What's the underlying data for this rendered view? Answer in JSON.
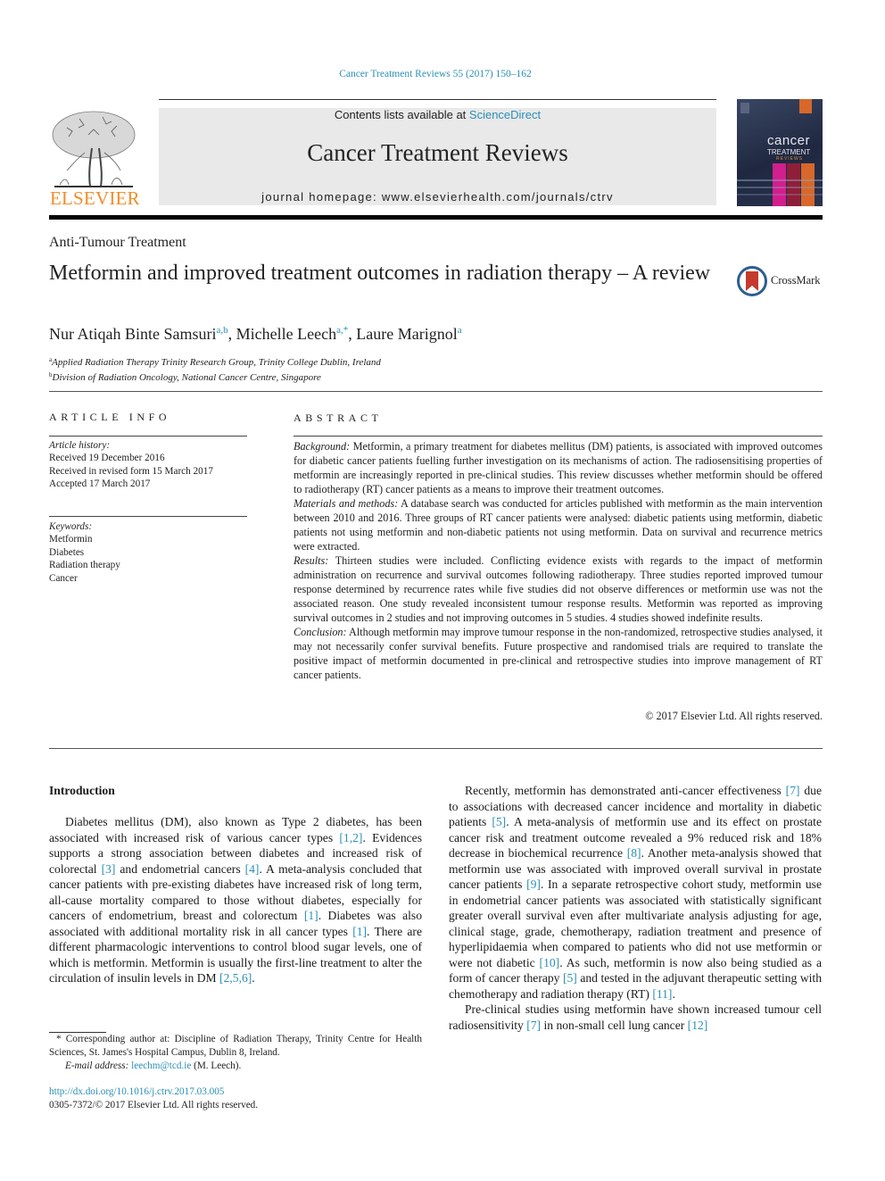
{
  "header": {
    "journal_citation": "Cancer Treatment Reviews 55 (2017) 150–162",
    "contents_prefix": "Contents lists available at ",
    "contents_link": "ScienceDirect",
    "journal_name": "Cancer Treatment Reviews",
    "homepage": "journal homepage: www.elsevierhealth.com/journals/ctrv",
    "publisher_logo_text": "ELSEVIER",
    "cover_title_line1": "cancer",
    "cover_title_line2": "TREATMENT",
    "cover_title_line3": "REVIEWS"
  },
  "article": {
    "section": "Anti-Tumour Treatment",
    "title": "Metformin and improved treatment outcomes in radiation therapy – A review",
    "crossmark_label": "CrossMark",
    "authors": [
      {
        "name": "Nur Atiqah Binte Samsuri",
        "sup": "a,b"
      },
      {
        "name": "Michelle Leech",
        "sup": "a,*"
      },
      {
        "name": "Laure Marignol",
        "sup": "a"
      }
    ],
    "affiliations": [
      {
        "mark": "a",
        "text": "Applied Radiation Therapy Trinity Research Group, Trinity College Dublin, Ireland"
      },
      {
        "mark": "b",
        "text": "Division of Radiation Oncology, National Cancer Centre, Singapore"
      }
    ]
  },
  "article_info": {
    "heading": "ARTICLE INFO",
    "history_label": "Article history:",
    "history": [
      "Received 19 December 2016",
      "Received in revised form 15 March 2017",
      "Accepted 17 March 2017"
    ],
    "keywords_label": "Keywords:",
    "keywords": [
      "Metformin",
      "Diabetes",
      "Radiation therapy",
      "Cancer"
    ]
  },
  "abstract": {
    "heading": "ABSTRACT",
    "sections": [
      {
        "label": "Background:",
        "text": "Metformin, a primary treatment for diabetes mellitus (DM) patients, is associated with improved outcomes for diabetic cancer patients fuelling further investigation on its mechanisms of action. The radiosensitising properties of metformin are increasingly reported in pre-clinical studies. This review discusses whether metformin should be offered to radiotherapy (RT) cancer patients as a means to improve their treatment outcomes."
      },
      {
        "label": "Materials and methods:",
        "text": "A database search was conducted for articles published with metformin as the main intervention between 2010 and 2016. Three groups of RT cancer patients were analysed: diabetic patients using metformin, diabetic patients not using metformin and non-diabetic patients not using metformin. Data on survival and recurrence metrics were extracted."
      },
      {
        "label": "Results:",
        "text": "Thirteen studies were included. Conflicting evidence exists with regards to the impact of metformin administration on recurrence and survival outcomes following radiotherapy. Three studies reported improved tumour response determined by recurrence rates while five studies did not observe differences or metformin use was not the associated reason. One study revealed inconsistent tumour response results. Metformin was reported as improving survival outcomes in 2 studies and not improving outcomes in 5 studies. 4 studies showed indefinite results."
      },
      {
        "label": "Conclusion:",
        "text": "Although metformin may improve tumour response in the non-randomized, retrospective studies analysed, it may not necessarily confer survival benefits. Future prospective and randomised trials are required to translate the positive impact of metformin documented in pre-clinical and retrospective studies into improve management of RT cancer patients."
      }
    ],
    "copyright": "© 2017 Elsevier Ltd. All rights reserved."
  },
  "body": {
    "intro_heading": "Introduction",
    "left_paragraph": [
      {
        "t": "Diabetes mellitus (DM), also known as Type 2 diabetes, has been associated with increased risk of various cancer types "
      },
      {
        "ref": "[1,2]"
      },
      {
        "t": ". Evidences supports a strong association between diabetes and increased risk of colorectal "
      },
      {
        "ref": "[3]"
      },
      {
        "t": " and endometrial cancers "
      },
      {
        "ref": "[4]"
      },
      {
        "t": ". A meta-analysis concluded that cancer patients with pre-existing diabetes have increased risk of long term, all-cause mortality compared to those without diabetes, especially for cancers of endometrium, breast and colorectum "
      },
      {
        "ref": "[1]"
      },
      {
        "t": ". Diabetes was also associated with additional mortality risk in all cancer types "
      },
      {
        "ref": "[1]"
      },
      {
        "t": ". There are different pharmacologic interventions to control blood sugar levels, one of which is metformin. Metformin is usually the first-line treatment to alter the circulation of insulin levels in DM "
      },
      {
        "ref": "[2,5,6]"
      },
      {
        "t": "."
      }
    ],
    "right_paragraph_1": [
      {
        "t": "Recently, metformin has demonstrated anti-cancer effectiveness "
      },
      {
        "ref": "[7]"
      },
      {
        "t": " due to associations with decreased cancer incidence and mortality in diabetic patients "
      },
      {
        "ref": "[5]"
      },
      {
        "t": ". A meta-analysis of metformin use and its effect on prostate cancer risk and treatment outcome revealed a 9% reduced risk and 18% decrease in biochemical recurrence "
      },
      {
        "ref": "[8]"
      },
      {
        "t": ". Another meta-analysis showed that metformin use was associated with improved overall survival in prostate cancer patients "
      },
      {
        "ref": "[9]"
      },
      {
        "t": ". In a separate retrospective cohort study, metformin use in endometrial cancer patients was associated with statistically significant greater overall survival even after multivariate analysis adjusting for age, clinical stage, grade, chemotherapy, radiation treatment and presence of hyperlipidaemia when compared to patients who did not use metformin or were not diabetic "
      },
      {
        "ref": "[10]"
      },
      {
        "t": ". As such, metformin is now also being studied as a form of cancer therapy "
      },
      {
        "ref": "[5]"
      },
      {
        "t": " and tested in the adjuvant therapeutic setting with chemotherapy and radiation therapy (RT) "
      },
      {
        "ref": "[11]"
      },
      {
        "t": "."
      }
    ],
    "right_paragraph_2": [
      {
        "t": "Pre-clinical studies using metformin have shown increased tumour cell radiosensitivity "
      },
      {
        "ref": "[7]"
      },
      {
        "t": " in non-small cell lung cancer "
      },
      {
        "ref": "[12]"
      }
    ]
  },
  "footnote": {
    "corresponding": "* Corresponding author at: Discipline of Radiation Therapy, Trinity Centre for Health Sciences, St. James's Hospital Campus, Dublin 8, Ireland.",
    "email_label": "E-mail address: ",
    "email": "leechm@tcd.ie",
    "email_suffix": " (M. Leech).",
    "doi": "http://dx.doi.org/10.1016/j.ctrv.2017.03.005",
    "issn_line": "0305-7372/© 2017 Elsevier Ltd. All rights reserved."
  },
  "colors": {
    "link": "#2a8fb5",
    "elsevier_orange": "#f28c28",
    "header_box": "#e9e9e9"
  }
}
